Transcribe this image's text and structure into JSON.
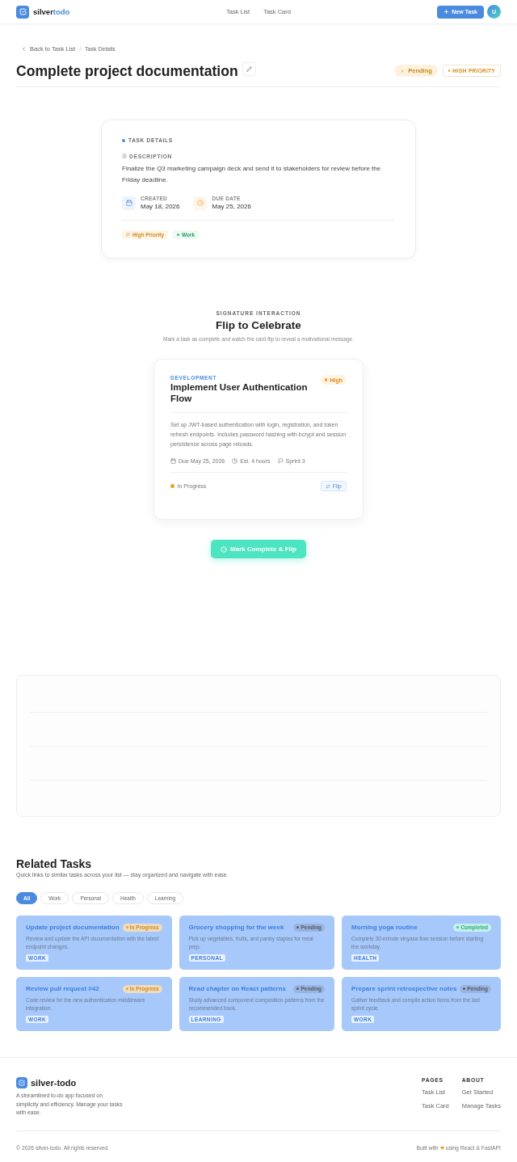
{
  "header": {
    "brand": {
      "first": "silver",
      "second": "todo"
    },
    "nav": [
      {
        "label": "Task List"
      },
      {
        "label": "Task Card"
      }
    ],
    "new_task": "New Task",
    "avatar": "U"
  },
  "breadcrumb": {
    "back": "Back to Task List",
    "separator": "/",
    "current": "Task Details"
  },
  "task": {
    "title": "Complete project documentation",
    "status": {
      "kind": "pending",
      "label": "Pending"
    },
    "priority": {
      "kind": "high",
      "label": "HIGH PRIORITY"
    }
  },
  "details": {
    "heading": "TASK DETAILS",
    "description_label": "DESCRIPTION",
    "description": "Finalize the Q3 marketing campaign deck and send it to stakeholders for review before the Friday deadline.",
    "meta": [
      {
        "kind": "created",
        "label": "CREATED",
        "value": "May 18, 2026"
      },
      {
        "kind": "due",
        "label": "DUE DATE",
        "value": "May 25, 2026"
      }
    ],
    "tags": [
      {
        "kind": "priority",
        "label": "High Priority"
      },
      {
        "kind": "category",
        "label": "Work"
      }
    ]
  },
  "signature": {
    "eyebrow": "SIGNATURE INTERACTION",
    "title": "Flip to Celebrate",
    "subtitle": "Mark a task as complete and watch the card flip to reveal a motivational message.",
    "card": {
      "category": "DEVELOPMENT",
      "title": "Implement User Authentication Flow",
      "priority": {
        "kind": "high",
        "label": "High"
      },
      "description": "Set up JWT-based authentication with login, registration, and token refresh endpoints. Includes password hashing with bcrypt and session persistence across page reloads.",
      "meta": [
        {
          "kind": "due",
          "label": "Due May 25, 2026"
        },
        {
          "kind": "estimate",
          "label": "Est. 4 hours"
        },
        {
          "kind": "sprint",
          "label": "Sprint 3"
        }
      ],
      "status": {
        "kind": "in_progress",
        "label": "In Progress"
      },
      "flip_button": "Flip"
    },
    "action": "Mark Complete & Flip"
  },
  "related": {
    "title": "Related Tasks",
    "subtitle": "Quick links to similar tasks across your list — stay organized and navigate with ease.",
    "filters": [
      {
        "label": "All",
        "selected": true
      },
      {
        "label": "Work",
        "selected": false
      },
      {
        "label": "Personal",
        "selected": false
      },
      {
        "label": "Health",
        "selected": false
      },
      {
        "label": "Learning",
        "selected": false
      }
    ],
    "tasks": [
      {
        "title": "Update project documentation",
        "status": {
          "kind": "in_progress",
          "label": "In Progress"
        },
        "description": "Review and update the API documentation with the latest endpoint changes.",
        "tag": "WORK"
      },
      {
        "title": "Grocery shopping for the week",
        "status": {
          "kind": "pending",
          "label": "Pending"
        },
        "description": "Pick up vegetables, fruits, and pantry staples for meal prep.",
        "tag": "PERSONAL"
      },
      {
        "title": "Morning yoga routine",
        "status": {
          "kind": "completed",
          "label": "Completed"
        },
        "description": "Complete 30-minute vinyasa flow session before starting the workday.",
        "tag": "HEALTH"
      },
      {
        "title": "Review pull request #42",
        "status": {
          "kind": "in_progress",
          "label": "In Progress"
        },
        "description": "Code review for the new authentication middleware integration.",
        "tag": "WORK"
      },
      {
        "title": "Read chapter on React patterns",
        "status": {
          "kind": "pending",
          "label": "Pending"
        },
        "description": "Study advanced component composition patterns from the recommended book.",
        "tag": "LEARNING"
      },
      {
        "title": "Prepare sprint retrospective notes",
        "status": {
          "kind": "pending",
          "label": "Pending"
        },
        "description": "Gather feedback and compile action items from the last sprint cycle.",
        "tag": "WORK"
      }
    ]
  },
  "footer": {
    "brand": "silver-todo",
    "description": "A streamlined to-do app focused on simplicity and efficiency. Manage your tasks with ease.",
    "columns": [
      {
        "heading": "PAGES",
        "links": [
          "Task List",
          "Task Card"
        ]
      },
      {
        "heading": "ABOUT",
        "links": [
          "Get Started",
          "Manage Tasks"
        ]
      }
    ],
    "copyright": "© 2026 silver-todo. All rights reserved.",
    "credit": {
      "before": "Built with",
      "after": "using React & FastAPI"
    }
  }
}
